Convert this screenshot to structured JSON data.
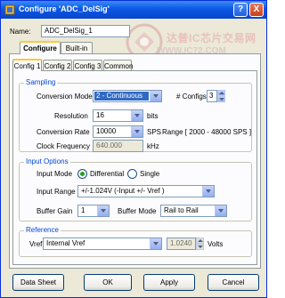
{
  "window": {
    "title": "Configure 'ADC_DelSig'",
    "help": "?",
    "close": "X"
  },
  "name": {
    "label": "Name:",
    "value": "ADC_DelSig_1"
  },
  "outer_tabs": [
    "Configure",
    "Built-in"
  ],
  "inner_tabs": [
    "Config 1",
    "Config 2",
    "Config 3",
    "Common"
  ],
  "sampling": {
    "title": "Sampling",
    "conversion_mode": {
      "label": "Conversion Mode",
      "value": "2 - Continuous"
    },
    "configs": {
      "label": "# Configs",
      "value": "3"
    },
    "resolution": {
      "label": "Resolution",
      "value": "16",
      "unit": "bits"
    },
    "conversion_rate": {
      "label": "Conversion Rate",
      "value": "10000",
      "unit": "SPS",
      "range": "Range [ 2000 - 48000 SPS ]"
    },
    "clock_frequency": {
      "label": "Clock Frequency",
      "value": "640.000",
      "unit": "kHz"
    }
  },
  "input_options": {
    "title": "Input Options",
    "input_mode": {
      "label": "Input Mode",
      "differential": "Differential",
      "single": "Single",
      "selected": "Differential"
    },
    "input_range": {
      "label": "Input Range",
      "value": "+/-1.024V (-Input +/- Vref )"
    },
    "buffer_gain": {
      "label": "Buffer Gain",
      "value": "1"
    },
    "buffer_mode": {
      "label": "Buffer Mode",
      "value": "Rail to Rail"
    }
  },
  "reference": {
    "title": "Reference",
    "vref": {
      "label": "Vref",
      "value": "Internal Vref"
    },
    "volts": {
      "value": "1.0240",
      "unit": "Volts"
    }
  },
  "buttons": {
    "datasheet": "Data Sheet",
    "ok": "OK",
    "apply": "Apply",
    "cancel": "Cancel"
  },
  "watermark": {
    "text": "达普IC芯片交易网",
    "url": "WWW.IC72.COM"
  },
  "colors": {
    "titlebar": "#0a58e6",
    "group_title": "#0046d5",
    "selection": "#316ac5",
    "watermark": "#e8b9b9"
  }
}
